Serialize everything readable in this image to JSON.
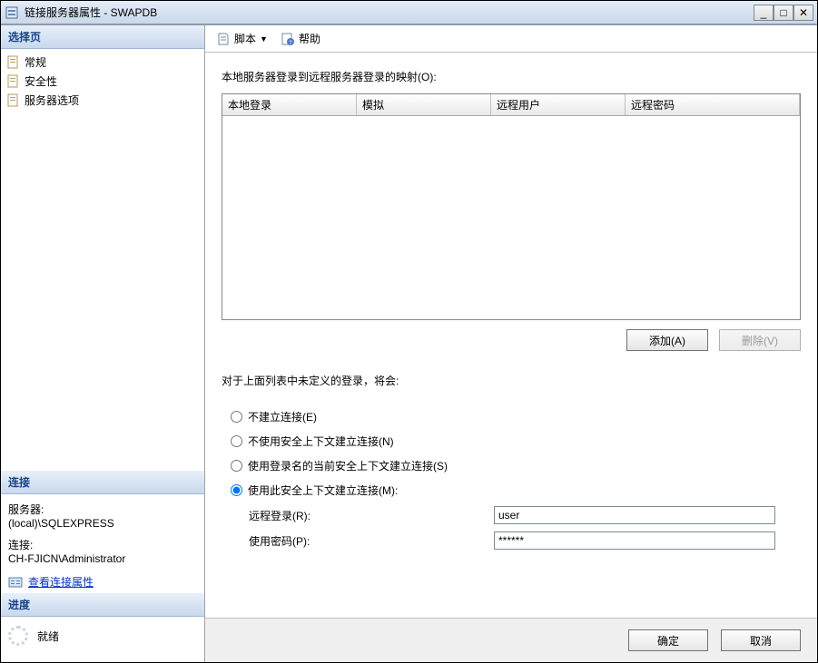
{
  "titlebar": {
    "title": "链接服务器属性 - SWAPDB"
  },
  "left": {
    "select_page_header": "选择页",
    "nav": {
      "general": "常规",
      "security": "安全性",
      "server_options": "服务器选项"
    },
    "connection_header": "连接",
    "server_label": "服务器:",
    "server_value": "(local)\\SQLEXPRESS",
    "conn_label": "连接:",
    "conn_value": "CH-FJICN\\Administrator",
    "view_conn_props": "查看连接属性",
    "progress_header": "进度",
    "ready": "就绪"
  },
  "toolbar": {
    "script": "脚本",
    "help": "帮助"
  },
  "main": {
    "mapping_label": "本地服务器登录到远程服务器登录的映射(O):",
    "grid_headers": {
      "local_login": "本地登录",
      "impersonate": "模拟",
      "remote_user": "远程用户",
      "remote_password": "远程密码"
    },
    "add_btn": "添加(A)",
    "remove_btn": "删除(V)",
    "undefined_label": "对于上面列表中未定义的登录，将会:",
    "radio": {
      "not_made": "不建立连接(E)",
      "no_sec_context": "不使用安全上下文建立连接(N)",
      "current_sec_context": "使用登录名的当前安全上下文建立连接(S)",
      "this_sec_context": "使用此安全上下文建立连接(M):"
    },
    "remote_login_label": "远程登录(R):",
    "with_password_label": "使用密码(P):",
    "remote_login_value": "user",
    "password_value": "******"
  },
  "footer": {
    "ok": "确定",
    "cancel": "取消"
  }
}
